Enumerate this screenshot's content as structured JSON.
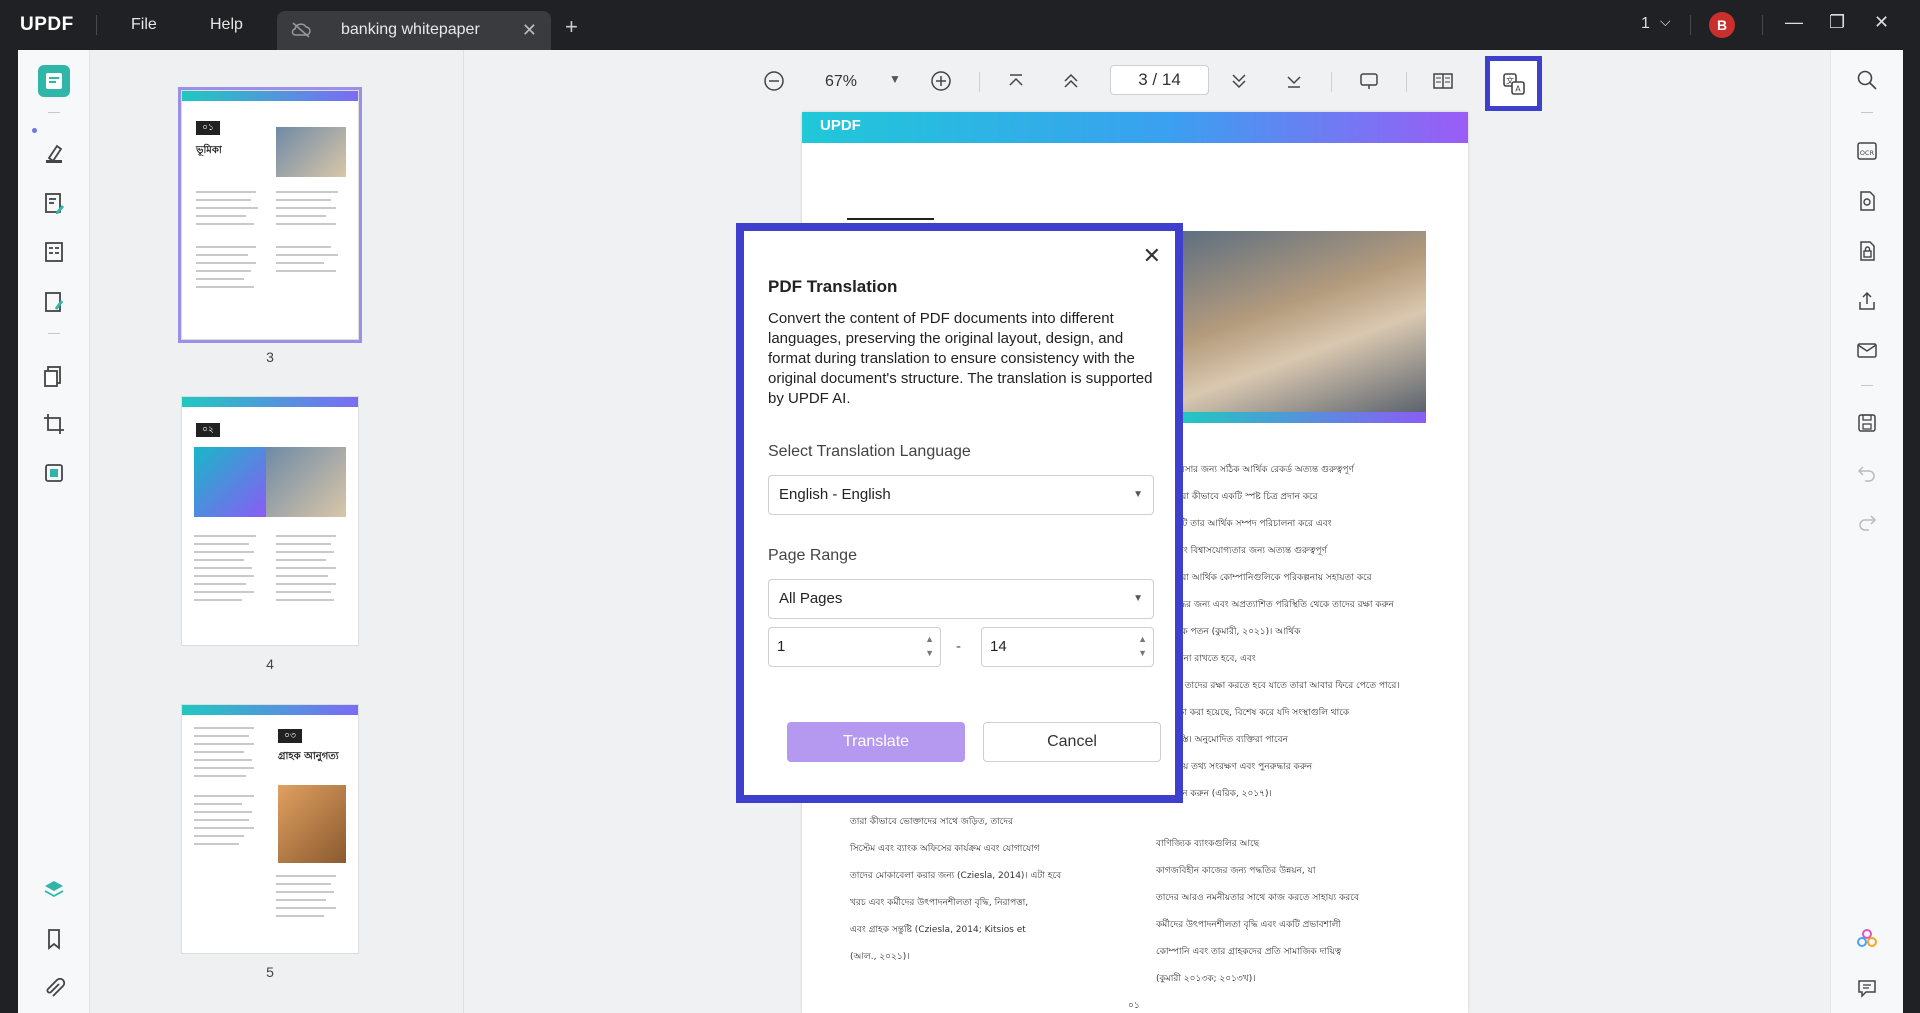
{
  "app": {
    "logo": "UPDF"
  },
  "menu": {
    "file": "File",
    "help": "Help"
  },
  "tab": {
    "title": "banking whitepaper",
    "close": "✕",
    "new": "+"
  },
  "window": {
    "page_indicator": "1",
    "chevron": "⌵",
    "avatar_letter": "B",
    "minimize": "—",
    "restore": "❐",
    "close": "✕"
  },
  "viewer": {
    "zoom": "67%",
    "current_page": "3",
    "page_separator": "/",
    "total_pages": "14"
  },
  "thumbnails": [
    {
      "number": "3",
      "selected": true,
      "badge": "০১",
      "title": "ভূমিকা"
    },
    {
      "number": "4",
      "selected": false,
      "badge": "০২"
    },
    {
      "number": "5",
      "selected": false,
      "badge": "০৩",
      "title": "গ্রাহক আনুগত্য"
    }
  ],
  "page": {
    "header_logo": "UPDF",
    "left_column": [
      "তারা কীভাবে ভোক্তাদের সাথে জড়িত, তাদের",
      "সিস্টেম এবং ব্যাংক অফিসের কার্যক্রম এবং যোগাযোগ",
      "তাদের মোকাবেলা করার জন্য (Cziesla, 2014)। এটা হবে",
      "খরচ এবং কর্মীদের উৎপাদনশীলতা বৃদ্ধি, নিরাপত্তা,",
      "এবং গ্রাহক সন্তুষ্টি (Cziesla, 2014; Kitsios et",
      "(আল., ২০২১)।"
    ],
    "right_column": [
      "ব্যবসার জন্য সঠিক আর্থিক রেকর্ড অত্যন্ত গুরুত্বপূর্ণ",
      "তারা কীভাবে একটি স্পষ্ট চিত্র প্রদান করে",
      "নিটি তার আর্থিক সম্পদ পরিচালনা করে এবং",
      "এবং বিশ্বাসযোগ্যতার জন্য অত্যন্ত গুরুত্বপূর্ণ",
      "তারা আর্থিক কোম্পানিগুলিকে পরিকল্পনায় সহায়তা করে",
      "বৃদ্ধির জন্য এবং অপ্রত্যাশিত পরিস্থিতি থেকে তাদের রক্ষা করুন",
      "তিক পতন (কুমারী, ২০২১)। আর্থিক",
      "বৃত্তনা রাখতে হবে, এবং",
      "কে তাদের রক্ষা করতে হবে যাতে তারা আবার ফিরে পেতে পারে।",
      "রক্ষা করা হয়েছে, বিশেষ করে যদি সংস্থাগুলি থাকে",
      "রিস্তি। অনুমোদিত ব্যক্তিরা পাবেন",
      "সময় তথ্য সংরক্ষণ এবং পুনরুদ্ধার করুন",
      "ফি প্রদান করুন (এরিক, ২০১৭)।",
      "বাণিজ্যিক ব্যাংকগুলির আছে",
      "কাগজবিহীন কাজের জন্য পদ্ধতির উন্নয়ন, যা",
      "তাদের আরও নমনীয়তার সাথে কাজ করতে সাহায্য করবে",
      "কর্মীদের উৎপাদনশীলতা বৃদ্ধি এবং একটি প্রভাবশালী",
      "কোম্পানি এবং তার গ্রাহকদের প্রতি সামাজিক দায়িত্ব",
      "(কুমারী ২০১৩ক; ২০১৩খ)।"
    ],
    "page_number": "০১"
  },
  "modal": {
    "title": "PDF Translation",
    "description": "Convert the content of PDF documents into different languages, preserving the original layout, design, and format during translation to ensure consistency with the original document's structure. The translation is supported by UPDF AI.",
    "language_label": "Select Translation Language",
    "language_value": "English - English",
    "range_label": "Page Range",
    "range_value": "All Pages",
    "range_from": "1",
    "range_to": "14",
    "range_dash": "-",
    "translate_label": "Translate",
    "cancel_label": "Cancel",
    "close": "✕"
  },
  "colors": {
    "accent": "#3f3fce",
    "primary_button": "#b598f0",
    "brand_gradient_start": "#20c8d8",
    "brand_gradient_end": "#9b5cf5",
    "avatar": "#c9302c"
  },
  "icons": {
    "left_toolbar": [
      "reader-icon",
      "highlighter-icon",
      "edit-pdf-icon",
      "form-icon",
      "sign-icon",
      "organize-pages-icon",
      "crop-icon",
      "stamp-icon",
      "layers-icon",
      "bookmark-icon",
      "attachment-icon"
    ],
    "right_toolbar": [
      "search-icon",
      "ocr-icon",
      "convert-icon",
      "protect-icon",
      "share-icon",
      "email-icon",
      "save-icon",
      "undo-icon",
      "redo-icon",
      "ai-icon",
      "comment-icon"
    ]
  }
}
